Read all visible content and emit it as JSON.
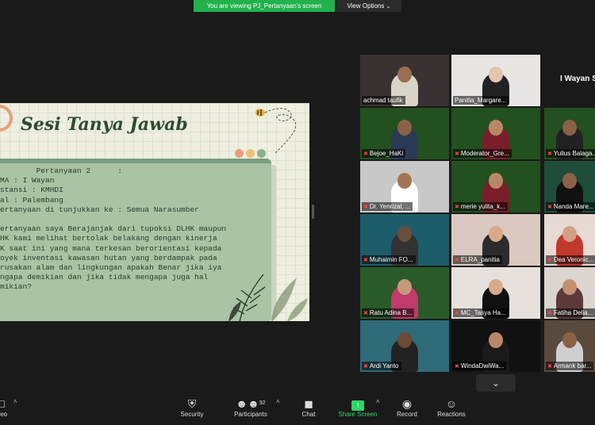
{
  "top_bar": {
    "viewing_text": "You are viewing PJ_Pertanyaan's screen",
    "view_options_label": "View Options"
  },
  "slide": {
    "title": "Sesi Tanya Jawab",
    "lines": [
      "        Pertanyaan 2      :",
      "MA : I Wayan",
      "stansi : KMHDI",
      "al : Palembang",
      "ertanyaan di tunjukkan ke : Semua Narasumber",
      "",
      "ertanyaan saya Berajanjak dari tupoksi DLHK maupun",
      "HK kami melihat bertolak belakang dengan kinerja",
      "K saat ini yang mana terkesan berorientasi kepada",
      "oyek inventasi kawasan hutan yang berdampak pada",
      "rusakan alam dan lingkungan apakah Benar jika iya",
      "ngapa demikian dan jika tidak mengapa juga hal",
      "mikian?"
    ],
    "dot_colors": [
      "#e8a07a",
      "#e9c27a",
      "#8fb08c"
    ]
  },
  "participants": {
    "side_name": "I Wayan S",
    "tiles": [
      {
        "name": "achmad taufik",
        "bg": "#3a3232",
        "skin": "#9a6e52",
        "shirt": "#d9d4c8",
        "muted": false
      },
      {
        "name": "Panitia_Margare...",
        "bg": "#e8e6e2",
        "skin": "#e3c6b0",
        "shirt": "#222222",
        "muted": false
      },
      {
        "name": "Bejoe_HaKi",
        "bg": "#23501f",
        "skin": "#8c6246",
        "shirt": "#2b3a55",
        "muted": true
      },
      {
        "name": "Moderator_Gre...",
        "bg": "#23501f",
        "skin": "#b88866",
        "shirt": "#7a1f2a",
        "muted": true
      },
      {
        "name": "Yulius Balaga...",
        "bg": "#23501f",
        "skin": "#8c6246",
        "shirt": "#222222",
        "muted": true
      },
      {
        "name": "Dr. Yenrizal, ...",
        "bg": "#c8c8c8",
        "skin": "#a47452",
        "shirt": "#ffffff",
        "muted": true
      },
      {
        "name": "merie yulita_k...",
        "bg": "#23501f",
        "skin": "#b88866",
        "shirt": "#7a1f2a",
        "muted": true
      },
      {
        "name": "Nanda Mare...",
        "bg": "#1e4d3a",
        "skin": "#8c6246",
        "shirt": "#111111",
        "muted": true
      },
      {
        "name": "Muhaimin FO...",
        "bg": "#1d5c6a",
        "skin": "#6a4e3c",
        "shirt": "#333333",
        "muted": true
      },
      {
        "name": "ELRA_panitia",
        "bg": "#d9c9c0",
        "skin": "#d9a98a",
        "shirt": "#2b2b2b",
        "muted": true
      },
      {
        "name": "Dea Veronic...",
        "bg": "#e7d9d3",
        "skin": "#d2a184",
        "shirt": "#c0392b",
        "muted": true
      },
      {
        "name": "Ratu Adina B...",
        "bg": "#2a5a2a",
        "skin": "#c49a7a",
        "shirt": "#c03a6a",
        "muted": true
      },
      {
        "name": "MC_Tasya Ha...",
        "bg": "#e6e1dc",
        "skin": "#d9aa8a",
        "shirt": "#111111",
        "muted": true
      },
      {
        "name": "Fatiha Delia...",
        "bg": "#ddd6d0",
        "skin": "#c4906e",
        "shirt": "#5a3a3a",
        "muted": true
      },
      {
        "name": "Ardi Yanto",
        "bg": "#2f6a78",
        "skin": "#6b4a38",
        "shirt": "#222222",
        "muted": true
      },
      {
        "name": "WindaDwiWa...",
        "bg": "#111111",
        "skin": "#b88866",
        "shirt": "#1a1a1a",
        "muted": true
      },
      {
        "name": "Armank bar...",
        "bg": "#5a4a3e",
        "skin": "#8c6246",
        "shirt": "#cfcfcf",
        "muted": true
      }
    ]
  },
  "toolbar": {
    "video_label": "ideo",
    "security_label": "Security",
    "participants_label": "Participants",
    "participants_count": "92",
    "chat_label": "Chat",
    "share_label": "Share Screen",
    "record_label": "Record",
    "reactions_label": "Reactions"
  }
}
